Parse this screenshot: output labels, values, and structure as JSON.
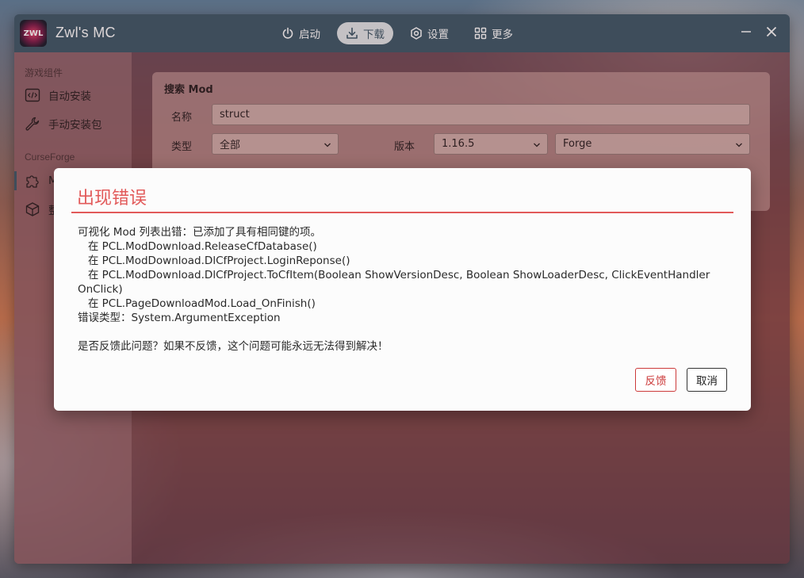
{
  "app": {
    "title": "Zwl's MC",
    "logo_text": "ZWL"
  },
  "nav": {
    "items": [
      {
        "label": "启动",
        "icon": "power-icon",
        "active": false
      },
      {
        "label": "下载",
        "icon": "download-icon",
        "active": true
      },
      {
        "label": "设置",
        "icon": "gear-icon",
        "active": false
      },
      {
        "label": "更多",
        "icon": "grid-icon",
        "active": false
      }
    ]
  },
  "sidebar": {
    "group1": "游戏组件",
    "items1": [
      {
        "label": "自动安装",
        "icon": "code-icon"
      },
      {
        "label": "手动安装包",
        "icon": "wrench-icon"
      }
    ],
    "group2": "CurseForge",
    "items2": [
      {
        "label": "M",
        "icon": "puzzle-icon"
      },
      {
        "label": "整",
        "icon": "box-icon"
      }
    ]
  },
  "search": {
    "title": "搜索 Mod",
    "name_label": "名称",
    "name_value": "struct",
    "type_label": "类型",
    "type_value": "全部",
    "version_label": "版本",
    "version_value": "1.16.5",
    "loader_value": "Forge"
  },
  "dialog": {
    "title": "出现错误",
    "lines": [
      "可视化 Mod 列表出错：已添加了具有相同键的项。",
      "   在 PCL.ModDownload.ReleaseCfDatabase()",
      "   在 PCL.ModDownload.DlCfProject.LoginReponse()",
      "   在 PCL.ModDownload.DlCfProject.ToCfItem(Boolean ShowVersionDesc, Boolean ShowLoaderDesc, ClickEventHandler OnClick)",
      "   在 PCL.PageDownloadMod.Load_OnFinish()",
      "错误类型：System.ArgumentException"
    ],
    "question": "是否反馈此问题？如果不反馈，这个问题可能永远无法得到解决！",
    "feedback_label": "反馈",
    "cancel_label": "取消"
  },
  "colors": {
    "titlebar": "#3f5868",
    "error_accent": "#e25a5a",
    "feedback_border": "#cc3a3a"
  }
}
